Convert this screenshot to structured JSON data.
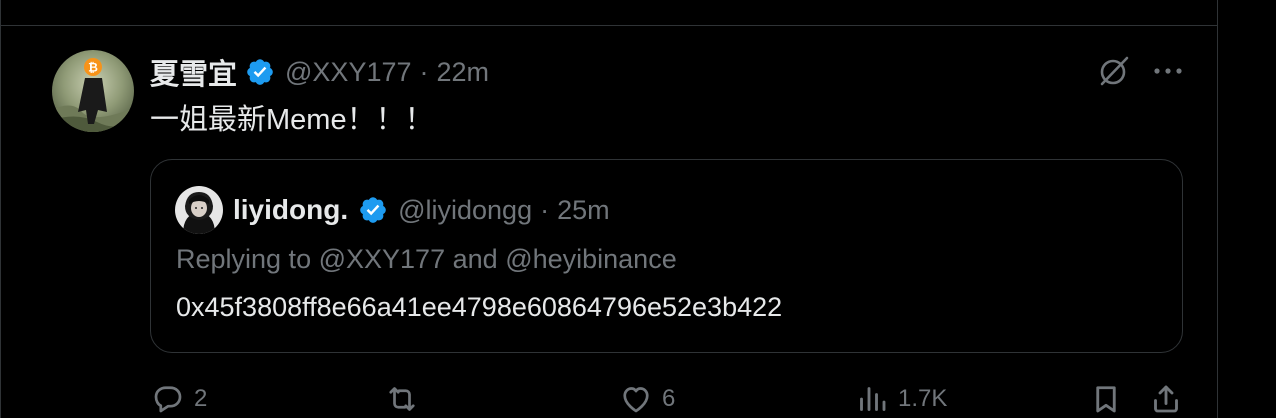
{
  "tweet": {
    "author": {
      "display_name": "夏雪宜",
      "handle": "@XXY177",
      "verified": true,
      "avatar_icon": "bitcoin-head-avatar"
    },
    "separator": "·",
    "time": "22m",
    "text": "一姐最新Meme！！！",
    "quoted": {
      "author": {
        "display_name": "liyidong.",
        "handle": "@liyidongg",
        "verified": true
      },
      "time": "25m",
      "replying_prefix": "Replying to",
      "replying_to": [
        "@XXY177",
        "@heyibinance"
      ],
      "replying_joiner": "and",
      "text": "0x45f3808ff8e66a41ee4798e60864796e52e3b422"
    },
    "actions": {
      "replies": "2",
      "retweets": "",
      "likes": "6",
      "views": "1.7K"
    }
  },
  "colors": {
    "background": "#000000",
    "text_primary": "#e7e9ea",
    "text_muted": "#71767b",
    "border": "#2f3336",
    "verified_blue": "#1d9bf0"
  }
}
